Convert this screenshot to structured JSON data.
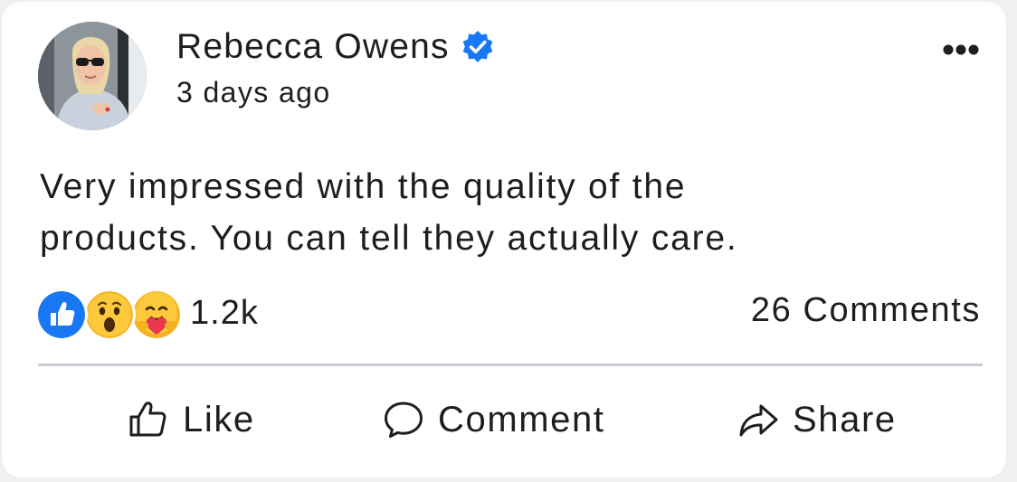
{
  "post": {
    "author": "Rebecca Owens",
    "verified": true,
    "timestamp": "3 days ago",
    "text_line1": "Very impressed with the quality of the",
    "text_line2": "products. You can tell they actually care.",
    "more_icon": "more-horizontal-icon"
  },
  "engagement": {
    "reactions": [
      "like",
      "wow",
      "care"
    ],
    "reaction_count": "1.2k",
    "comments_count": "26 Comments"
  },
  "actions": {
    "like_label": "Like",
    "comment_label": "Comment",
    "share_label": "Share"
  },
  "colors": {
    "verified_blue": "#1877f2",
    "text": "#1c1e21",
    "divider": "#c6ccd3"
  }
}
